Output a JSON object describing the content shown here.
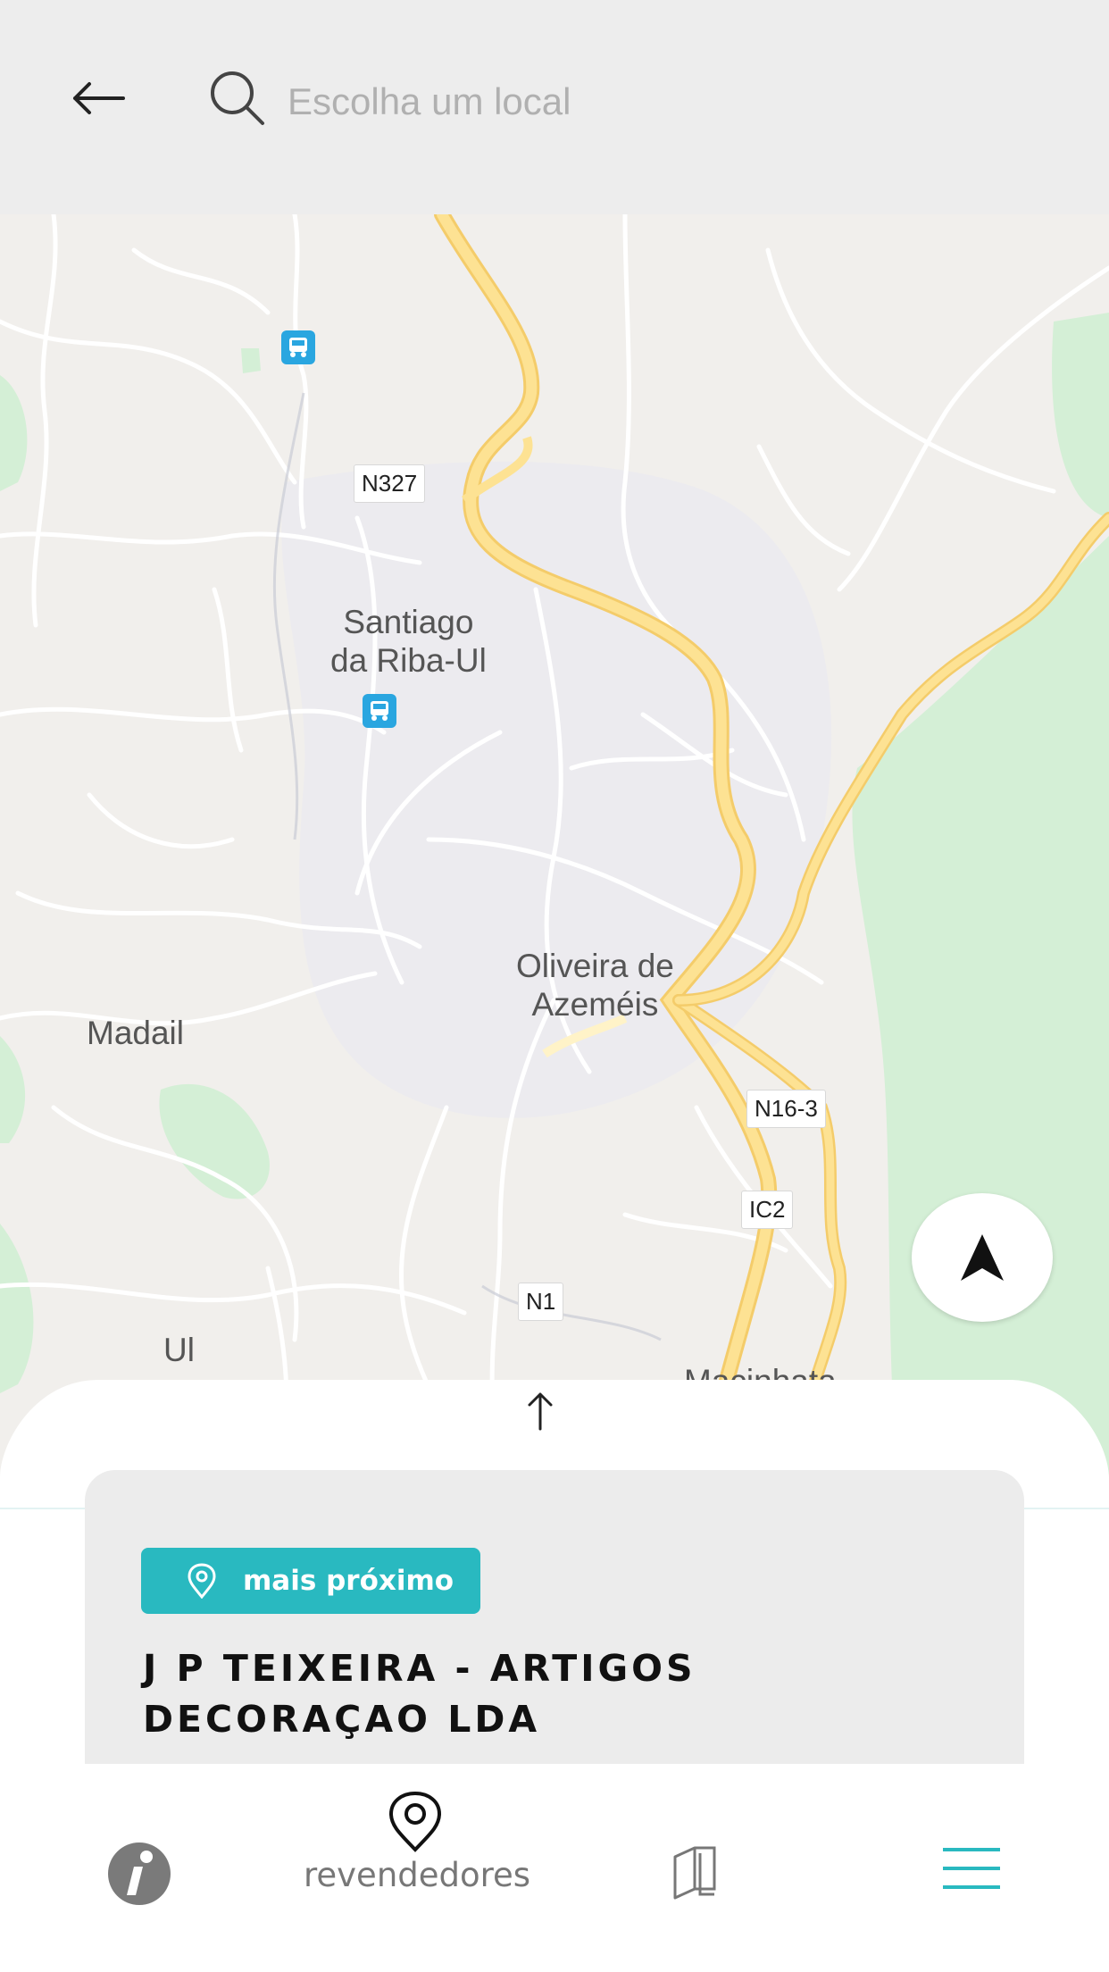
{
  "search": {
    "placeholder": "Escolha um local"
  },
  "map": {
    "places": {
      "santiago_line1": "Santiago",
      "santiago_line2": "da Riba-Ul",
      "oliveira_line1": "Oliveira de",
      "oliveira_line2": "Azeméis",
      "madail": "Madail",
      "ul": "Ul",
      "macinhata": "Macinhata"
    },
    "roads": {
      "n327": "N327",
      "n16_3": "N16-3",
      "ic2": "IC2",
      "n1": "N1"
    }
  },
  "dealer": {
    "badge_label": "mais próximo",
    "name": "J P TEIXEIRA - ARTIGOS DECORAÇAO LDA"
  },
  "nav": {
    "dealers_label": "revendedores"
  },
  "colors": {
    "accent": "#29b9c0",
    "highway": "#fde293",
    "park": "#d4efd6"
  }
}
